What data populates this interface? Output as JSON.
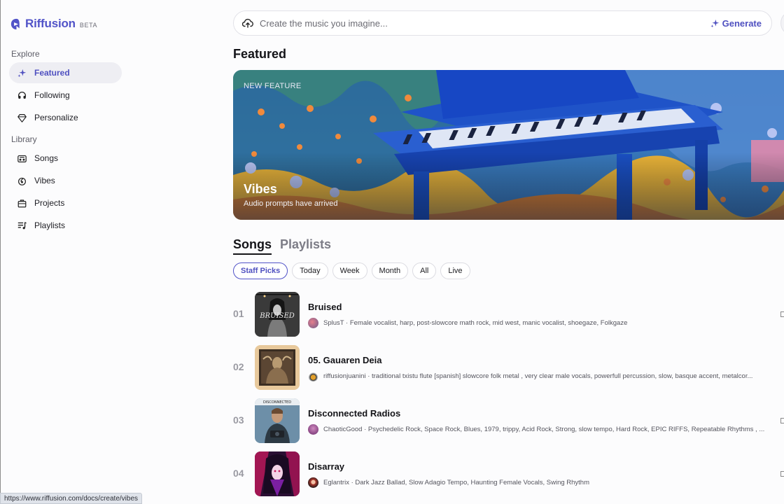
{
  "brand": {
    "name": "Riffusion",
    "badge": "BETA",
    "accent": "#5153c8"
  },
  "sidebar": {
    "explore_label": "Explore",
    "library_label": "Library",
    "explore_items": [
      {
        "label": "Featured",
        "icon": "sparkle-icon",
        "active": true
      },
      {
        "label": "Following",
        "icon": "headphones-icon",
        "active": false
      },
      {
        "label": "Personalize",
        "icon": "gem-icon",
        "active": false
      }
    ],
    "library_items": [
      {
        "label": "Songs",
        "icon": "boombox-icon"
      },
      {
        "label": "Vibes",
        "icon": "vibes-icon"
      },
      {
        "label": "Projects",
        "icon": "briefcase-icon"
      },
      {
        "label": "Playlists",
        "icon": "playlist-icon"
      }
    ]
  },
  "search": {
    "placeholder": "Create the music you imagine...",
    "value": "",
    "generate_label": "Generate"
  },
  "featured": {
    "heading": "Featured",
    "banner": {
      "eyebrow": "NEW FEATURE",
      "title": "Vibes",
      "subtitle": "Audio prompts have arrived"
    }
  },
  "tabs": [
    {
      "label": "Songs",
      "active": true
    },
    {
      "label": "Playlists",
      "active": false
    }
  ],
  "filters": [
    {
      "label": "Staff Picks",
      "active": true
    },
    {
      "label": "Today",
      "active": false
    },
    {
      "label": "Week",
      "active": false
    },
    {
      "label": "Month",
      "active": false
    },
    {
      "label": "All",
      "active": false
    },
    {
      "label": "Live",
      "active": false
    }
  ],
  "songs": [
    {
      "rank": "01",
      "title": "Bruised",
      "description": "SplusT · Female vocalist, harp, post-slowcore math rock, mid west, manic vocalist, shoegaze, Folkgaze"
    },
    {
      "rank": "02",
      "title": "05. Gauaren Deia",
      "description": "riffusionjuanini · traditional txistu flute [spanish] slowcore folk metal , very clear male vocals, powerfull percussion, slow, basque accent, metalcor..."
    },
    {
      "rank": "03",
      "title": "Disconnected Radios",
      "description": "ChaoticGood · Psychedelic Rock, Space Rock, Blues, 1979, trippy, Acid Rock, Strong, slow tempo, Hard Rock, EPIC RIFFS, Repeatable Rhythms , ..."
    },
    {
      "rank": "04",
      "title": "Disarray",
      "description": "Eglantrix · Dark Jazz Ballad, Slow Adagio Tempo, Haunting Female Vocals, Swing Rhythm"
    }
  ],
  "status_bar": {
    "url": "https://www.riffusion.com/docs/create/vibes"
  }
}
